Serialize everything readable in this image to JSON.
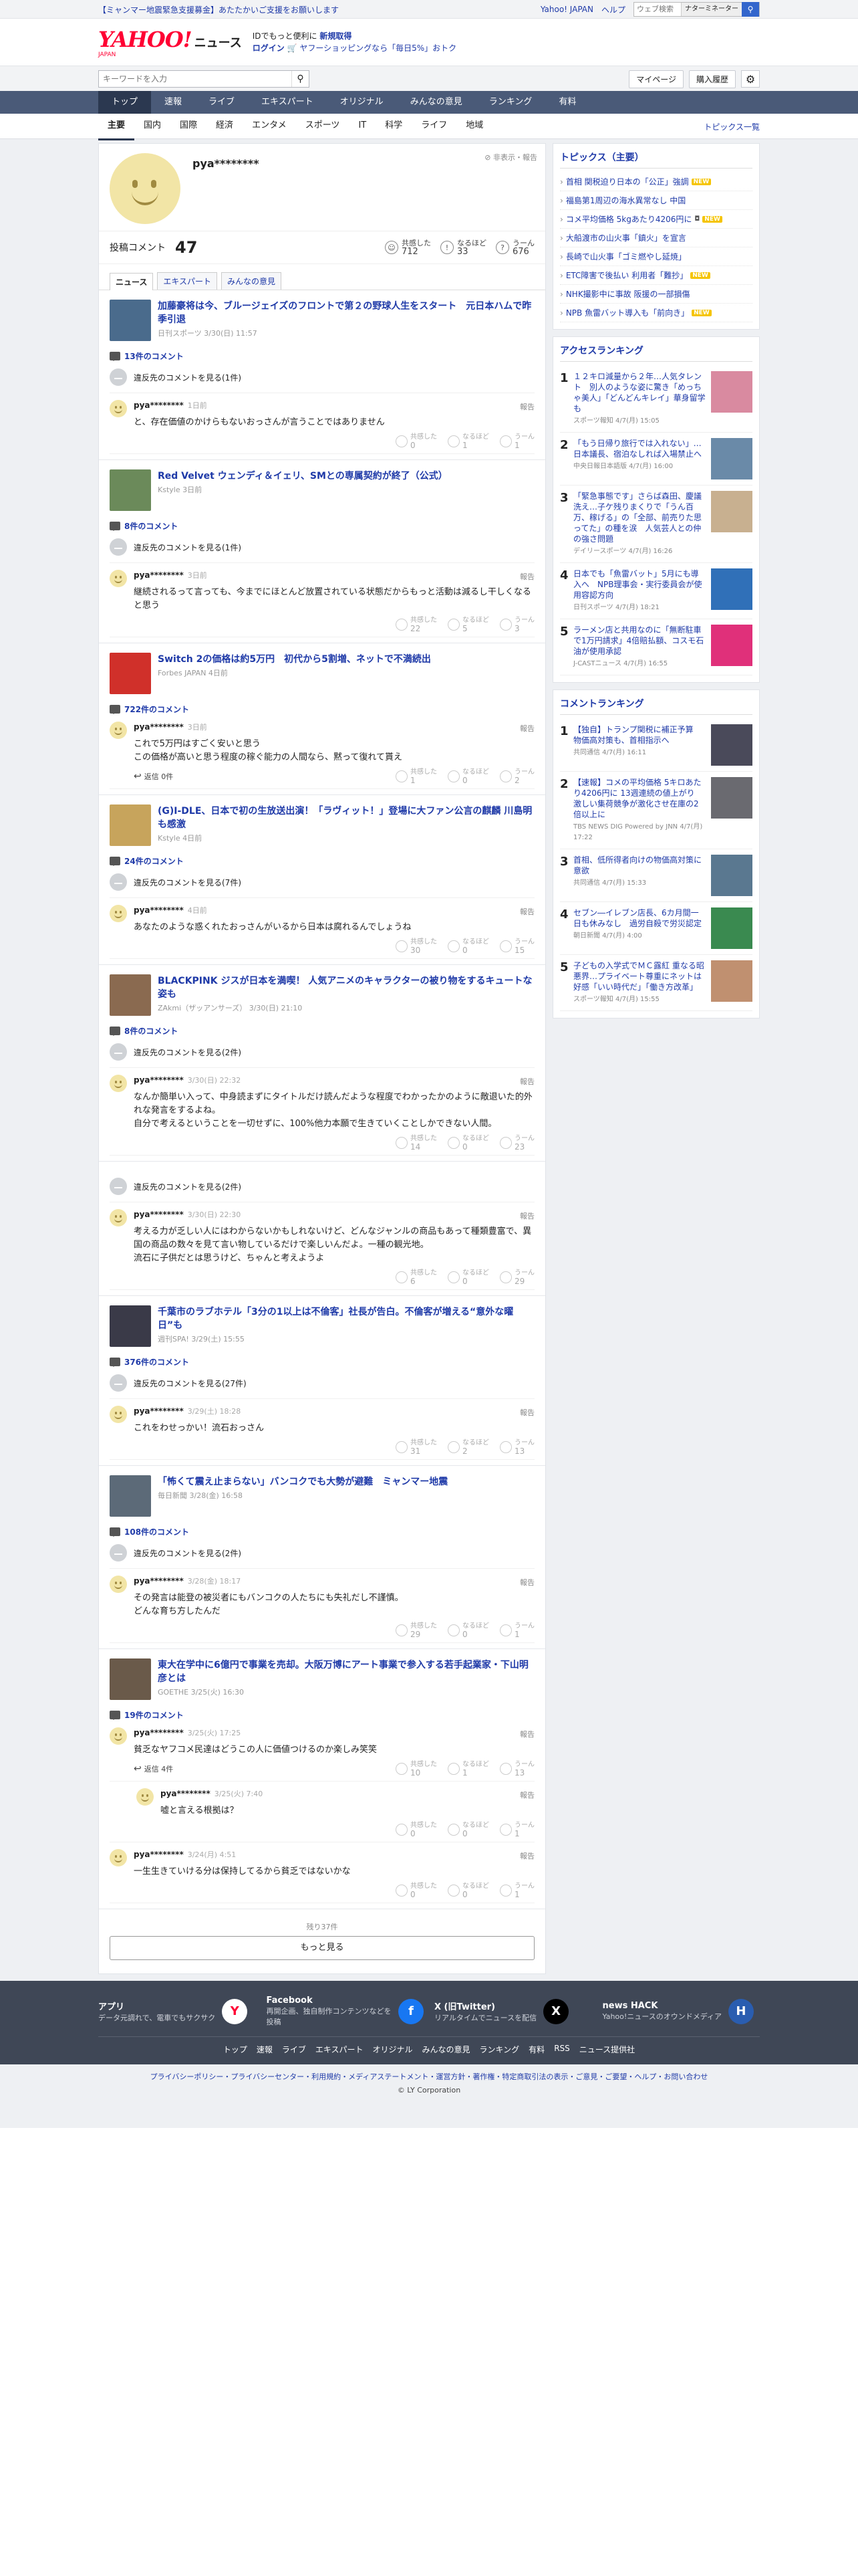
{
  "topstrip": {
    "notice": "【ミャンマー地震緊急支援募金】あたたかいご支援をお願いします",
    "links": [
      "Yahoo! JAPAN",
      "ヘルプ"
    ],
    "search_placeholder": "ウェブ検索",
    "search_button": "ナターミネーター"
  },
  "header": {
    "logo": "YAHOO!",
    "logo_sub": "JAPAN",
    "logo_news": "ニュース",
    "promo_line1_pre": "IDでもっと便利に",
    "promo_line1_link": "新規取得",
    "promo_line2_link": "ログイン",
    "promo_line2_text": "ヤフーショッピングなら「毎日5%」おトク"
  },
  "searchrow": {
    "placeholder": "キーワードを入力",
    "mypage": "マイページ",
    "history": "購入履歴"
  },
  "mainnav": [
    "トップ",
    "速報",
    "ライブ",
    "エキスパート",
    "オリジナル",
    "みんなの意見",
    "ランキング",
    "有料"
  ],
  "subnav": [
    "主要",
    "国内",
    "国際",
    "経済",
    "エンタメ",
    "スポーツ",
    "IT",
    "科学",
    "ライフ",
    "地域"
  ],
  "subnav_right": "トピックス一覧",
  "profile": {
    "name": "pya********",
    "report": "非表示・報告",
    "posts_label": "投稿コメント",
    "posts_count": "47",
    "reactions": [
      {
        "icon": "☺",
        "label": "共感した",
        "count": "712"
      },
      {
        "icon": "!",
        "label": "なるほど",
        "count": "33"
      },
      {
        "icon": "?",
        "label": "うーん",
        "count": "676"
      }
    ],
    "tabs": [
      "ニュース",
      "エキスパート",
      "みんなの意見"
    ]
  },
  "reaction_labels": [
    "共感した",
    "なるほど",
    "うーん"
  ],
  "report_label": "報告",
  "articles": [
    {
      "title": "加藤豪将は今、ブルージェイズのフロントで第２の野球人生をスタート　元日本ハムで昨季引退",
      "meta": "日刊スポーツ 3/30(日) 11:57",
      "thumb_color": "#4a6b8c",
      "comments_count": "13件のコメント",
      "hidden": "違反先のコメントを見る(1件)",
      "comments": [
        {
          "user": "pya********",
          "time": "1日前",
          "text": "と、存在価値のかけらもないおっさんが言うことではありません",
          "r": [
            "0",
            "1",
            "1"
          ]
        }
      ]
    },
    {
      "title": "Red Velvet ウェンディ＆イェリ、SMとの専属契約が終了（公式）",
      "meta": "Kstyle 3日前",
      "thumb_color": "#6b8a5a",
      "comments_count": "8件のコメント",
      "hidden": "違反先のコメントを見る(1件)",
      "comments": [
        {
          "user": "pya********",
          "time": "3日前",
          "text": "継続されるって言っても、今までにほとんど放置されている状態だからもっと活動は減るし干しくなると思う",
          "r": [
            "22",
            "5",
            "3"
          ]
        }
      ]
    },
    {
      "title": "Switch 2の価格は約5万円　初代から5割増、ネットで不満続出",
      "meta": "Forbes JAPAN 4日前",
      "thumb_color": "#d0302a",
      "comments_count": "722件のコメント",
      "hidden": "",
      "comments": [
        {
          "user": "pya********",
          "time": "3日前",
          "text": "これで5万円はすごく安いと思う\nこの価格が高いと思う程度の稼ぐ能力の人間なら、黙って復れて貰え",
          "r": [
            "1",
            "0",
            "2"
          ],
          "replies": "返信 0件"
        }
      ]
    },
    {
      "title": "(G)I-DLE、日本で初の生放送出演！「ラヴィット！」登場に大ファン公言の麒麟 川島明も感激",
      "meta": "Kstyle 4日前",
      "thumb_color": "#c7a45c",
      "comments_count": "24件のコメント",
      "hidden": "違反先のコメントを見る(7件)",
      "comments": [
        {
          "user": "pya********",
          "time": "4日前",
          "text": "あなたのような惑くれたおっさんがいるから日本は腐れるんでしょうね",
          "r": [
            "30",
            "0",
            "15"
          ]
        }
      ]
    },
    {
      "title": "BLACKPINK ジスが日本を満喫！ 人気アニメのキャラクターの被り物をするキュートな姿も",
      "meta": "ZAkmi（ザッアンサーズ） 3/30(日) 21:10",
      "thumb_color": "#8a6a50",
      "comments_count": "8件のコメント",
      "hidden": "違反先のコメントを見る(2件)",
      "comments": [
        {
          "user": "pya********",
          "time": "3/30(日) 22:32",
          "text": "なんか簡単い入って、中身読まずにタイトルだけ読んだような程度でわかったかのように敵退いた的外れな発言をするよね。\n自分で考えるということを一切せずに、100%他力本願で生きていくことしかできない人間。",
          "r": [
            "14",
            "0",
            "23"
          ]
        }
      ]
    },
    {
      "title": "",
      "meta": "",
      "thumb_color": "",
      "comments_count": "",
      "hidden": "違反先のコメントを見る(2件)",
      "comments": [
        {
          "user": "pya********",
          "time": "3/30(日) 22:30",
          "text": "考える力が乏しい人にはわからないかもしれないけど、どんなジャンルの商品もあって種類豊富で、異国の商品の数々を見て言い物しているだけで楽しいんだよ。一種の観光地。\n流石に子供だとは思うけど、ちゃんと考えようよ",
          "r": [
            "6",
            "0",
            "29"
          ]
        }
      ]
    },
    {
      "title": "千葉市のラブホテル「3分の1以上は不倫客」社長が告白。不倫客が増える“意外な曜日”も",
      "meta": "週刊SPA! 3/29(土) 15:55",
      "thumb_color": "#3a3a48",
      "comments_count": "376件のコメント",
      "hidden": "違反先のコメントを見る(27件)",
      "comments": [
        {
          "user": "pya********",
          "time": "3/29(土) 18:28",
          "text": "これをわせっかい！流石おっさん",
          "r": [
            "31",
            "2",
            "13"
          ]
        }
      ]
    },
    {
      "title": "「怖くて震え止まらない」バンコクでも大勢が避難　ミャンマー地震",
      "meta": "毎日新聞 3/28(金) 16:58",
      "thumb_color": "#5c6a78",
      "comments_count": "108件のコメント",
      "hidden": "違反先のコメントを見る(2件)",
      "comments": [
        {
          "user": "pya********",
          "time": "3/28(金) 18:17",
          "text": "その発言は能登の被災者にもバンコクの人たちにも失礼だし不謹慎。\nどんな育ち方したんだ",
          "r": [
            "29",
            "0",
            "1"
          ]
        }
      ]
    },
    {
      "title": "東大在学中に6億円で事業を売却。大阪万博にアート事業で参入する若手起業家・下山明彦とは",
      "meta": "GOETHE 3/25(火) 16:30",
      "thumb_color": "#6a5a4a",
      "comments_count": "19件のコメント",
      "hidden": "",
      "comments": [
        {
          "user": "pya********",
          "time": "3/25(火) 17:25",
          "text": "貧乏なヤフコメ民達はどうこの人に価値つけるのか楽しみ笑笑",
          "r": [
            "10",
            "1",
            "13"
          ],
          "replies": "返信 4件"
        },
        {
          "user": "pya********",
          "time": "3/25(火) 7:40",
          "text": "嘘と言える根拠は？",
          "r": [
            "0",
            "0",
            "1"
          ],
          "indent": true
        },
        {
          "user": "pya********",
          "time": "3/24(月) 4:51",
          "text": "一生生きていける分は保持してるから貧乏ではないかな",
          "r": [
            "0",
            "0",
            "1"
          ]
        }
      ]
    }
  ],
  "more": {
    "remaining": "残り37件",
    "button": "もっと見る"
  },
  "sidebar": {
    "topics_head": "トピックス（主要）",
    "topics": [
      {
        "text": "首相 関税迫り日本の「公正」強調",
        "badge": "NEW",
        "cam": ""
      },
      {
        "text": "福島第1周辺の海水異常なし 中国",
        "badge": "",
        "cam": ""
      },
      {
        "text": "コメ平均価格 5kgあたり4206円に",
        "badge": "NEW",
        "cam": "◘"
      },
      {
        "text": "大船渡市の山火事「鎮火」を宣言",
        "badge": "",
        "cam": ""
      },
      {
        "text": "長崎で山火事「ゴミ燃やし延焼」",
        "badge": "",
        "cam": ""
      },
      {
        "text": "ETC障害で後払い 利用者「難抄」",
        "badge": "NEW",
        "cam": ""
      },
      {
        "text": "NHK撮影中に事故 阪援の一部損傷",
        "badge": "",
        "cam": ""
      },
      {
        "text": "NPB 魚雷バット導入も「前向き」",
        "badge": "NEW",
        "cam": ""
      }
    ],
    "access_head": "アクセスランキング",
    "access": [
      {
        "title": "１２キロ減量から２年…人気タレント　別人のような姿に驚き「めっちゃ美人」「どんどんキレイ」華身留学も",
        "meta": "スポーツ報知 4/7(月) 15:05",
        "color": "#d98aa0"
      },
      {
        "title": "「もう日帰り旅行では入れない」…日本議長、宿泊なしれば入場禁止へ",
        "meta": "中央日報日本語版 4/7(月) 16:00",
        "color": "#6a8aa8"
      },
      {
        "title": "「緊急事態です」さらば森田、慶議洗え…子ケ残りまくりで「うん百万、稼げる」の「全部、前売りた思ってた」の種を涙　人気芸人との仲の強さ問題",
        "meta": "デイリースポーツ 4/7(月) 16:26",
        "color": "#c8b090"
      },
      {
        "title": "日本でも「魚雷バット」5月にも導入へ　NPB理事会・実行委員会が使用容認方向",
        "meta": "日刊スポーツ 4/7(月) 18:21",
        "color": "#3070b8"
      },
      {
        "title": "ラーメン店と共用なのに「無断駐車で1万円請求」4倍賠払額、コスモ石油が使用承認",
        "meta": "J-CASTニュース 4/7(月) 16:55",
        "color": "#e0307a"
      }
    ],
    "comment_head": "コメントランキング",
    "comment_rank": [
      {
        "title": "【独自】トランプ関税に補正予算　物価高対策も、首相指示へ",
        "meta": "共同通信 4/7(月) 16:11",
        "color": "#4a4a5a"
      },
      {
        "title": "【速報】コメの平均価格 5キロあたり4206円に 13週連続の値上がり　激しい集荷競争が激化させ在庫の2倍以上に",
        "meta": "TBS NEWS DIG Powered by JNN 4/7(月) 17:22",
        "color": "#6a6a70"
      },
      {
        "title": "首相、低所得者向けの物価高対策に意欲",
        "meta": "共同通信 4/7(月) 15:33",
        "color": "#5a7890"
      },
      {
        "title": "セブン―イレブン店長、6カ月間一日も休みなし　過労自殺で労災認定",
        "meta": "朝日新聞 4/7(月) 4:00",
        "color": "#3a8a50"
      },
      {
        "title": "子どもの入学式でＭＣ露紅 重なる昭悪界…プライベート尊重にネットは好感「いい時代だ」「働き方改革」",
        "meta": "スポーツ報知 4/7(月) 15:55",
        "color": "#c09070"
      }
    ]
  },
  "footer": {
    "apps": [
      {
        "name": "アプリ",
        "desc": "データ元調れで、電車でもサクサク",
        "icon": "Y",
        "bg": "#ffffff",
        "fg": "#ff0033"
      },
      {
        "name": "Facebook",
        "desc": "再開企画、独自制作コンテンツなどを投稿",
        "icon": "f",
        "bg": "#1877f2",
        "fg": "#ffffff"
      },
      {
        "name": "X (旧Twitter)",
        "desc": "リアルタイムでニュースを配信",
        "icon": "X",
        "bg": "#000000",
        "fg": "#ffffff"
      },
      {
        "name": "news HACK",
        "desc": "Yahoo!ニュースのオウンドメディア",
        "icon": "H",
        "bg": "#2a5db0",
        "fg": "#ffffff"
      }
    ],
    "nav": [
      "トップ",
      "速報",
      "ライブ",
      "エキスパート",
      "オリジナル",
      "みんなの意見",
      "ランキング",
      "有料",
      "RSS",
      "ニュース提供社"
    ],
    "bottom_links": "プライバシーポリシー・プライバシーセンター・利用規約・メディアステートメント・運営方針・著作権・特定商取引法の表示・ご意見・ご要望・ヘルプ・お問い合わせ",
    "copyright": "© LY Corporation"
  }
}
